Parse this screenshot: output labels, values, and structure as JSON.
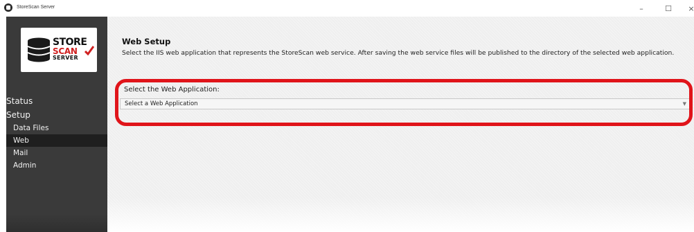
{
  "window": {
    "title": "StoreScan Server",
    "minimize_glyph": "–",
    "maximize_glyph": "☐",
    "close_glyph": "×"
  },
  "logo": {
    "line1": "STORE",
    "line2": "SCAN",
    "line3": "SERVER",
    "icon": "database-icon",
    "check_icon": "checkmark-icon"
  },
  "nav": {
    "status": "Status",
    "setup": "Setup",
    "items": [
      {
        "label": "Data Files",
        "active": false
      },
      {
        "label": "Web",
        "active": true
      },
      {
        "label": "Mail",
        "active": false
      },
      {
        "label": "Admin",
        "active": false
      }
    ]
  },
  "main": {
    "title": "Web Setup",
    "description": "Select the IIS web application that represents the StoreScan web service.  After saving the web service files will be published to the directory of the selected web application.",
    "field_label": "Select the Web Application:",
    "select_value": "Select a Web Application",
    "select_arrow_icon": "chevron-down-icon"
  },
  "colors": {
    "sidebar": "#3a3a3a",
    "sidebar_active": "#1f1f1f",
    "highlight": "#e0141a",
    "content_bg": "#efefef"
  }
}
